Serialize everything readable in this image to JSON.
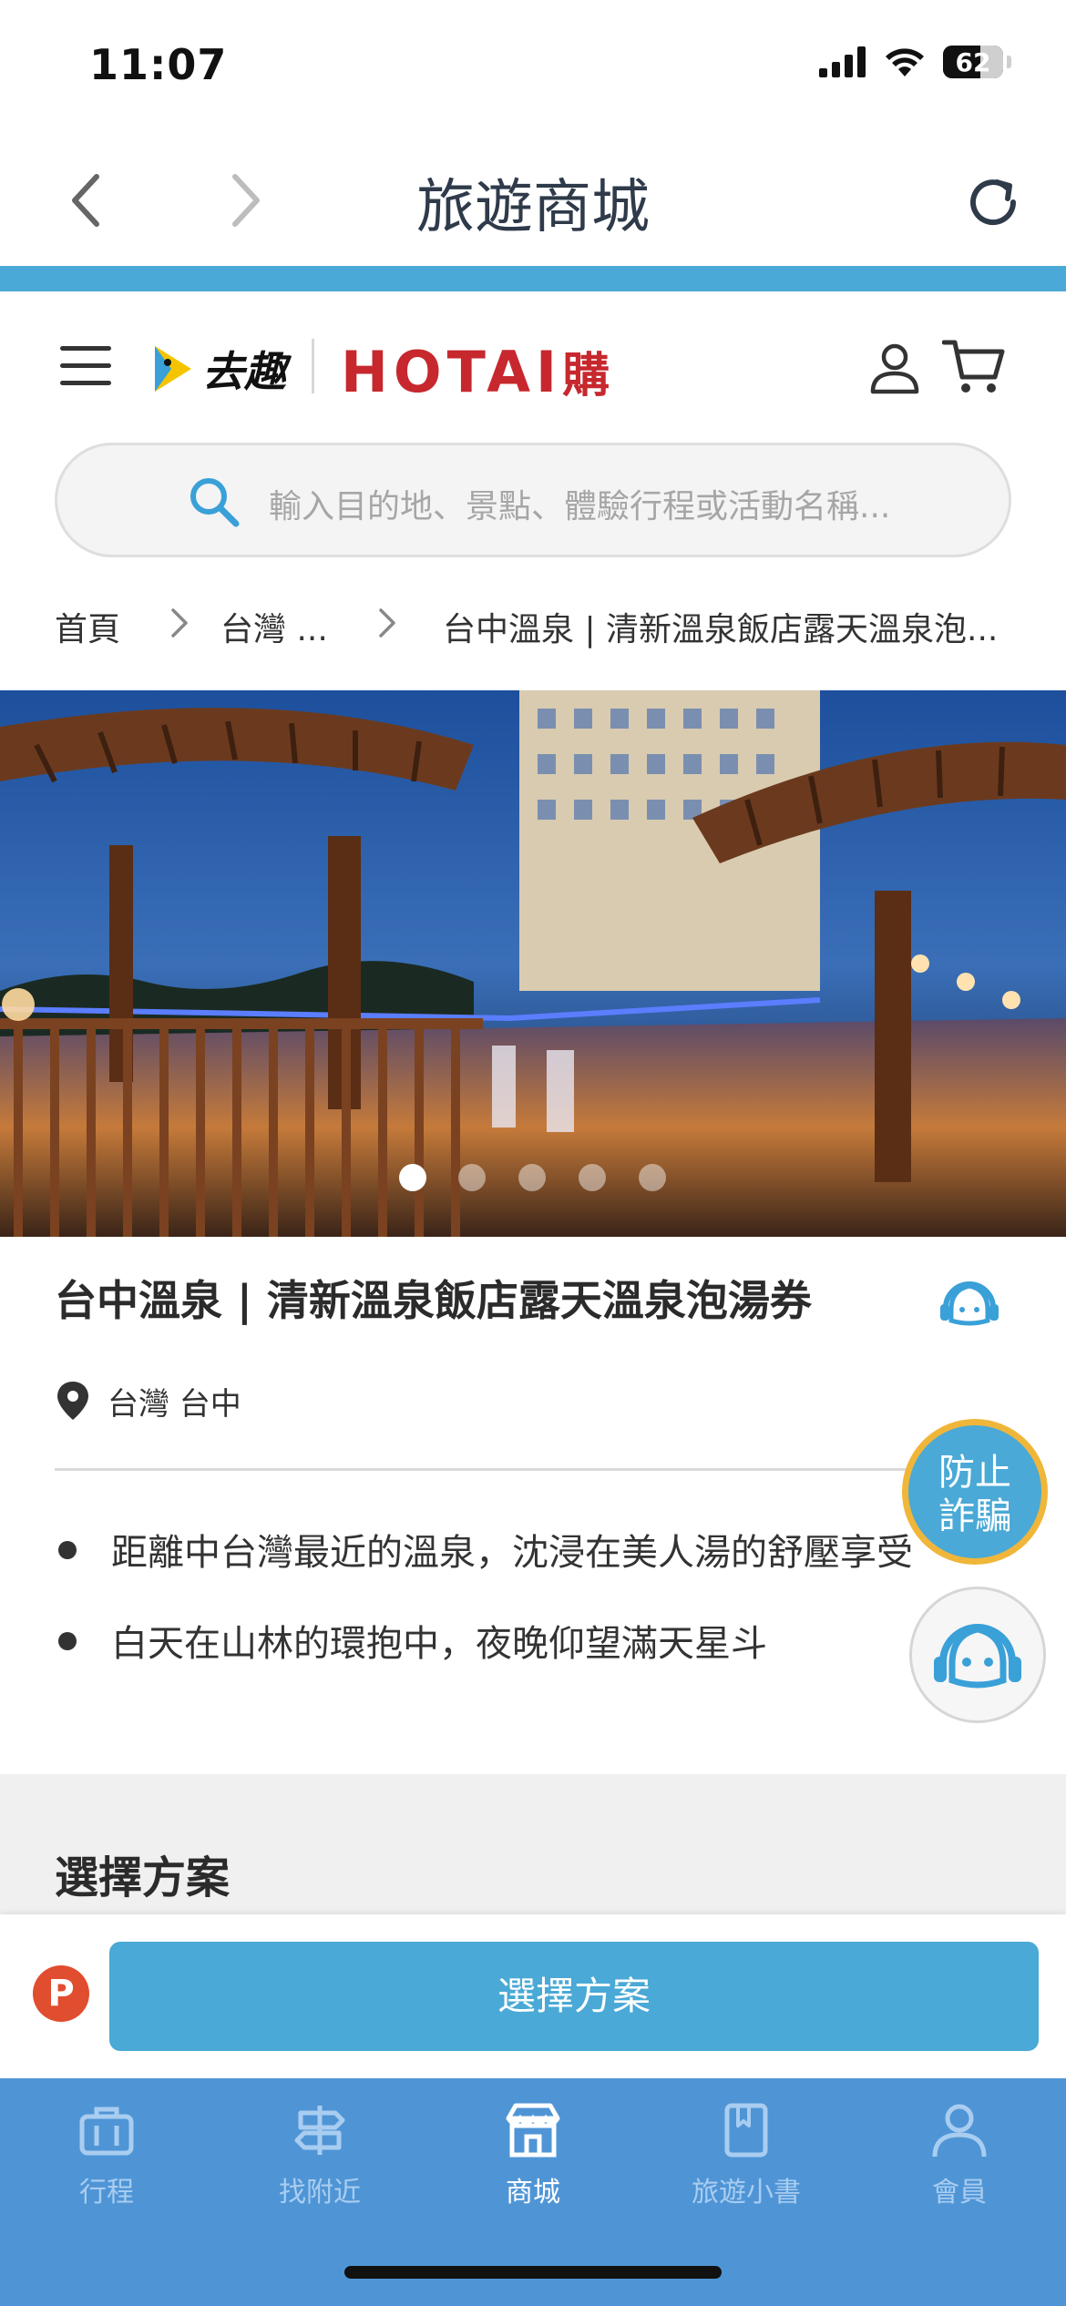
{
  "status_bar": {
    "time": "11:07",
    "battery": "62",
    "battery_level": 0.62,
    "icons": [
      "signal-icon",
      "wifi-icon",
      "battery-icon"
    ]
  },
  "nav_bar": {
    "title": "旅遊商城",
    "icons": [
      "back-chevron-icon",
      "forward-chevron-icon",
      "reload-icon"
    ]
  },
  "header": {
    "logo_quqi": "去趣",
    "logo_hotai": "HOTAI",
    "logo_hotai_sub": "購",
    "icons": [
      "menu-icon",
      "user-icon",
      "cart-icon"
    ]
  },
  "search": {
    "placeholder": "輸入目的地、景點、體驗行程或活動名稱..."
  },
  "breadcrumb": {
    "items": [
      "首頁",
      "台灣 ...",
      "台中溫泉 | 清新溫泉飯店露天溫泉泡..."
    ]
  },
  "carousel": {
    "count": 5,
    "active_index": 0
  },
  "product": {
    "title": "台中溫泉 | 清新溫泉飯店露天溫泉泡湯券",
    "location": "台灣 台中",
    "bullets": [
      "距離中台灣最近的溫泉，沈浸在美人湯的舒壓享受",
      "白天在山林的環抱中，夜晚仰望滿天星斗"
    ]
  },
  "floating": {
    "fraud_line1": "防止",
    "fraud_line2": "詐騙"
  },
  "plan_section": {
    "heading": "選擇方案"
  },
  "action_bar": {
    "points_badge": "P",
    "choose_button": "選擇方案"
  },
  "tab_bar": {
    "items": [
      {
        "label": "行程",
        "icon": "suitcase-icon"
      },
      {
        "label": "找附近",
        "icon": "signpost-icon"
      },
      {
        "label": "商城",
        "icon": "store-icon"
      },
      {
        "label": "旅遊小書",
        "icon": "book-icon"
      },
      {
        "label": "會員",
        "icon": "person-icon"
      }
    ],
    "active_index": 2
  },
  "colors": {
    "accent_blue": "#4aa9d6",
    "tab_bar_blue": "#4f95d6",
    "hotai_red": "#c6282e",
    "fraud_border": "#f0b63a"
  }
}
